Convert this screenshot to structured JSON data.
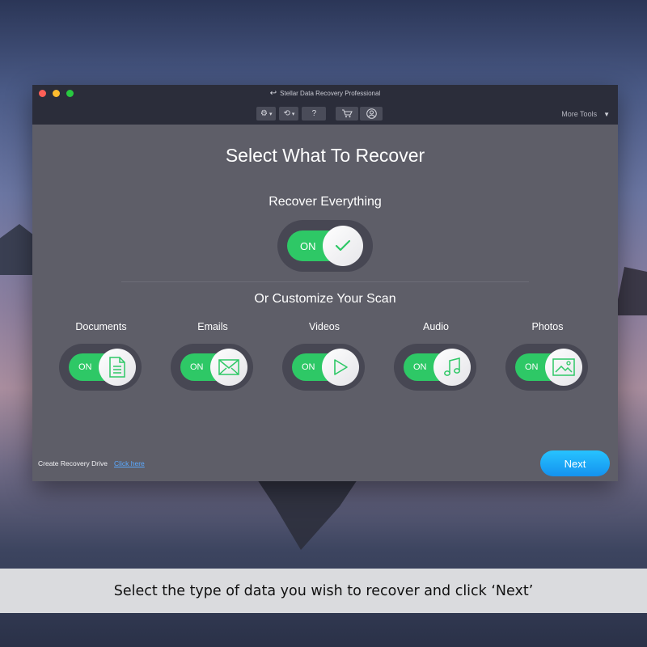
{
  "window": {
    "title": "Stellar Data Recovery Professional",
    "more_tools": "More Tools"
  },
  "toolbar": {
    "settings_icon": "gear-icon",
    "history_icon": "history-icon",
    "help_label": "?",
    "cart_icon": "cart-icon",
    "account_icon": "user-icon"
  },
  "main": {
    "title": "Select What To Recover",
    "recover_everything": {
      "label": "Recover Everything",
      "toggle_state": "ON"
    },
    "customize_label": "Or Customize Your Scan",
    "categories": [
      {
        "label": "Documents",
        "state": "ON",
        "icon": "document-icon"
      },
      {
        "label": "Emails",
        "state": "ON",
        "icon": "envelope-icon"
      },
      {
        "label": "Videos",
        "state": "ON",
        "icon": "play-icon"
      },
      {
        "label": "Audio",
        "state": "ON",
        "icon": "music-note-icon"
      },
      {
        "label": "Photos",
        "state": "ON",
        "icon": "image-icon"
      }
    ]
  },
  "footer": {
    "create_drive_text": "Create Recovery Drive",
    "click_here": "Click here",
    "next_label": "Next"
  },
  "caption": "Select the type of data you wish to recover and click ‘Next’",
  "colors": {
    "toggle_green": "#2ec866",
    "next_blue": "#1a9ff2",
    "window_body": "#5e5e68",
    "titlebar": "#2b2d3a"
  }
}
